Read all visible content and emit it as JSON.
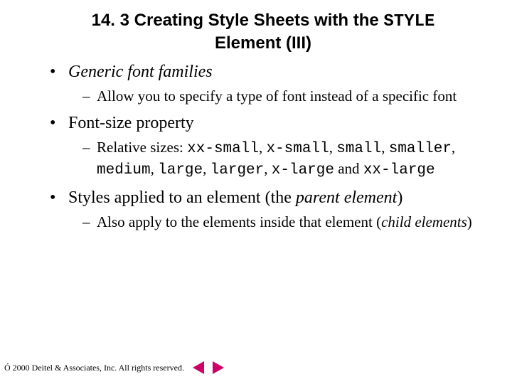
{
  "title": {
    "prefix": "14. 3 Creating Style Sheets with the ",
    "mono": "STYLE",
    "suffix": " Element (III)"
  },
  "bullets": {
    "b1": {
      "text": "Generic font families",
      "sub1": "Allow you to specify a type of font instead of a specific font"
    },
    "b2": {
      "text": "Font-size property",
      "sub1": {
        "lead": "Relative sizes: ",
        "m1": "xx-small",
        "c1": ", ",
        "m2": "x-small",
        "c2": ", ",
        "m3": "small",
        "c3": ", ",
        "m4": "smaller",
        "c4": ", ",
        "m5": "medium",
        "c5": ", ",
        "m6": "large",
        "c6": ", ",
        "m7": "larger",
        "c7": ", ",
        "m8": "x-large",
        "and": " and ",
        "m9": "xx-large"
      }
    },
    "b3": {
      "lead": "Styles applied to an element (the ",
      "italic": "parent element",
      "tail": ")",
      "sub1": {
        "lead": "Also apply to the elements inside that element (",
        "italic": "child elements",
        "tail": ")"
      }
    }
  },
  "footer": {
    "copyright": "Ó 2000 Deitel & Associates, Inc.  All rights reserved."
  },
  "nav": {
    "prev": "previous-slide",
    "next": "next-slide"
  }
}
